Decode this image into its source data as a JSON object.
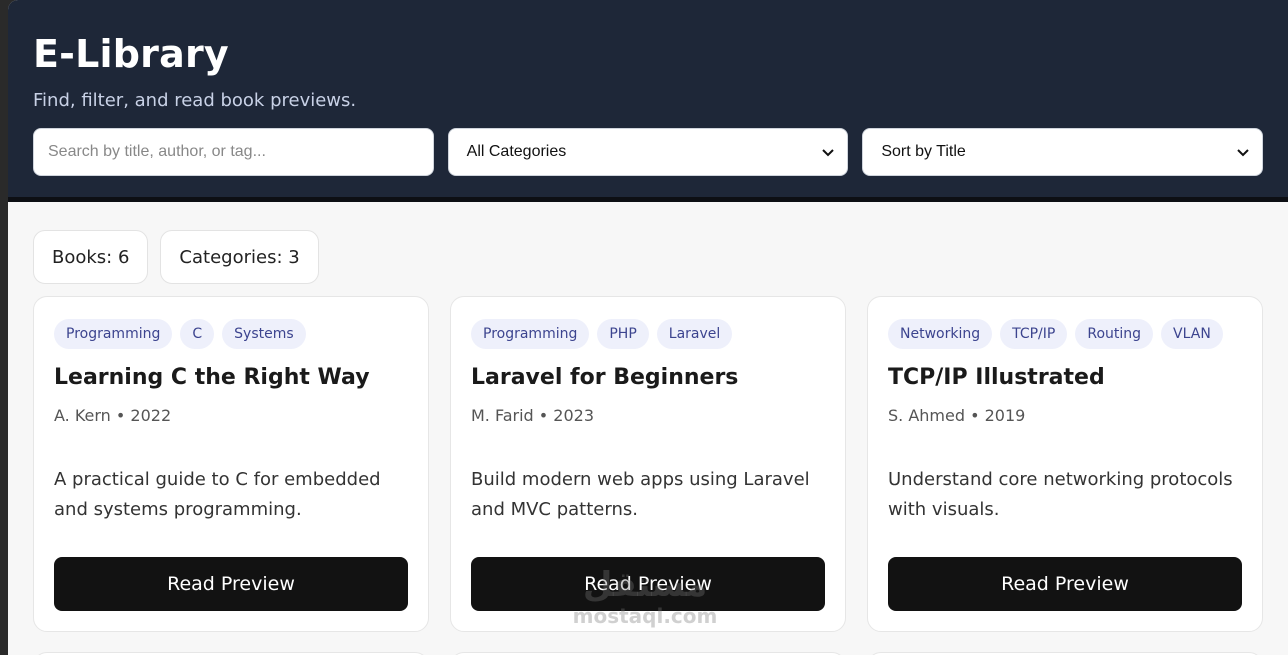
{
  "header": {
    "title": "E-Library",
    "subtitle": "Find, filter, and read book previews.",
    "search_placeholder": "Search by title, author, or tag...",
    "category_select": "All Categories",
    "sort_select": "Sort by Title"
  },
  "stats": {
    "books": "Books: 6",
    "categories": "Categories: 3"
  },
  "books": [
    {
      "tags": [
        "Programming",
        "C",
        "Systems"
      ],
      "title": "Learning C the Right Way",
      "meta": "A. Kern • 2022",
      "description": "A practical guide to C for embedded and systems programming.",
      "button": "Read Preview"
    },
    {
      "tags": [
        "Programming",
        "PHP",
        "Laravel"
      ],
      "title": "Laravel for Beginners",
      "meta": "M. Farid • 2023",
      "description": "Build modern web apps using Laravel and MVC patterns.",
      "button": "Read Preview"
    },
    {
      "tags": [
        "Networking",
        "TCP/IP",
        "Routing",
        "VLAN"
      ],
      "title": "TCP/IP Illustrated",
      "meta": "S. Ahmed • 2019",
      "description": "Understand core networking protocols with visuals.",
      "button": "Read Preview"
    }
  ],
  "watermark": {
    "arabic": "مستقل",
    "latin": "mostaql.com"
  }
}
